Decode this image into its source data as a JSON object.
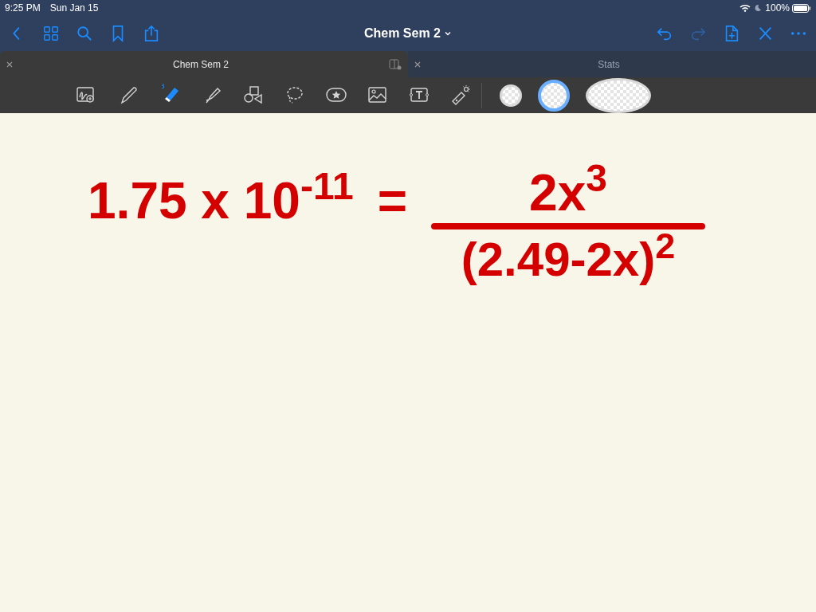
{
  "status_bar": {
    "time": "9:25 PM",
    "date": "Sun Jan 15",
    "battery": "100%"
  },
  "nav_bar": {
    "title": "Chem Sem 2",
    "left_icons": [
      {
        "kind": "back"
      },
      {
        "kind": "grid"
      },
      {
        "kind": "search"
      },
      {
        "kind": "bookmark"
      },
      {
        "kind": "share"
      }
    ],
    "right_icons": [
      {
        "kind": "undo"
      },
      {
        "kind": "redo"
      },
      {
        "kind": "add-page"
      },
      {
        "kind": "pen-off"
      },
      {
        "kind": "more"
      }
    ]
  },
  "tabs": [
    {
      "label": "Chem Sem 2",
      "selected": true
    },
    {
      "label": "Stats",
      "selected": false
    }
  ],
  "toolbar": {
    "tools": [
      {
        "kind": "zoom",
        "selected": false
      },
      {
        "kind": "pen",
        "selected": false
      },
      {
        "kind": "eraser",
        "selected": true
      },
      {
        "kind": "highlighter",
        "selected": false
      },
      {
        "kind": "shapes",
        "selected": false
      },
      {
        "kind": "lasso",
        "selected": false
      },
      {
        "kind": "sticker",
        "selected": false
      },
      {
        "kind": "image",
        "selected": false
      },
      {
        "kind": "text",
        "selected": false
      },
      {
        "kind": "laser",
        "selected": false
      }
    ],
    "sizes": [
      {
        "selected": false
      },
      {
        "selected": true
      },
      {
        "selected": false
      }
    ]
  },
  "ink": {
    "left_side": "1.75 x 10$^{-11}$",
    "equals": "=",
    "numerator": "2x$^{3}$",
    "denominator": "(2.49-2x)$^{2}$"
  }
}
